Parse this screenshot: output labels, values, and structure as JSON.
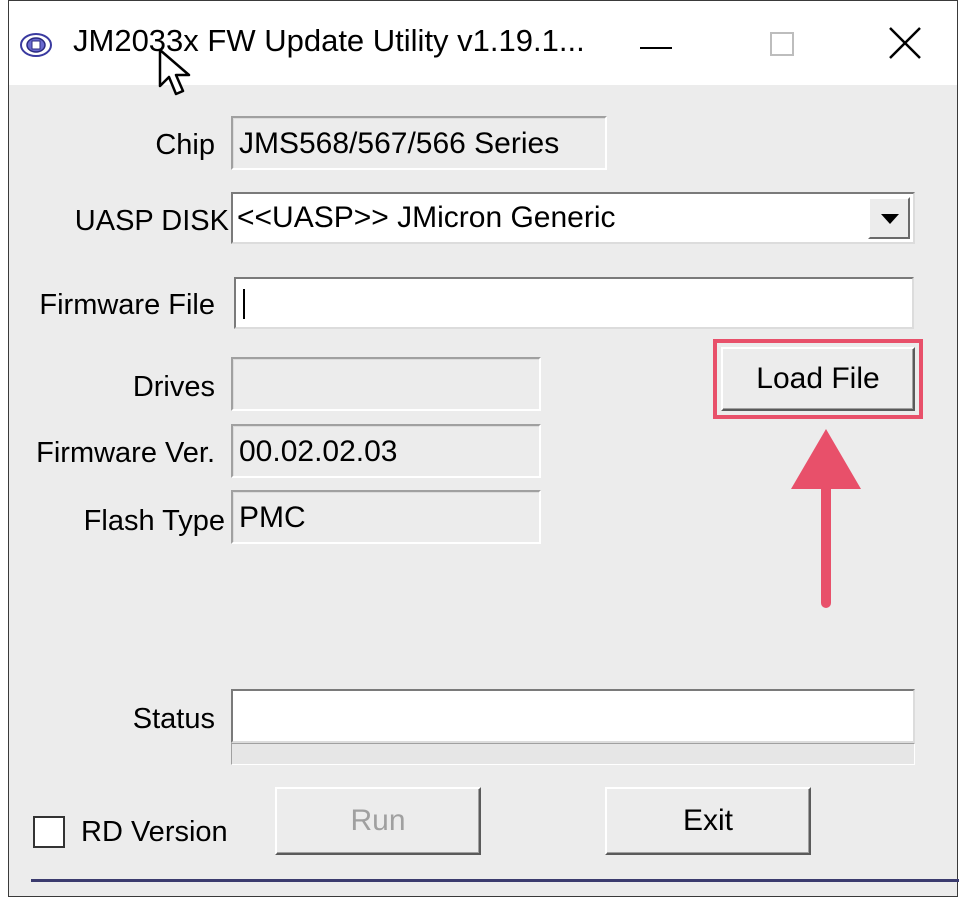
{
  "window": {
    "title": "JM2033x FW Update Utility v1.19.1...",
    "icons": {
      "app": "app-icon",
      "minimize": "minimize-icon",
      "maximize": "maximize-icon",
      "close": "close-icon"
    }
  },
  "form": {
    "chip_label": "Chip",
    "chip_value": "JMS568/567/566 Series",
    "uasp_label": "UASP DISK",
    "uasp_value": "<<UASP>> JMicron Generic",
    "firmware_file_label": "Firmware File",
    "firmware_file_value": "",
    "drives_label": "Drives",
    "drives_value": "",
    "firmware_ver_label": "Firmware Ver.",
    "firmware_ver_value": "00.02.02.03",
    "flash_type_label": "Flash Type",
    "flash_type_value": "PMC",
    "status_label": "Status",
    "status_value": "",
    "progress": 0
  },
  "buttons": {
    "load_file": "Load File",
    "run": "Run",
    "exit": "Exit"
  },
  "rd_version": {
    "label": "RD Version",
    "checked": false
  },
  "annotation": {
    "color": "#e8506a"
  }
}
